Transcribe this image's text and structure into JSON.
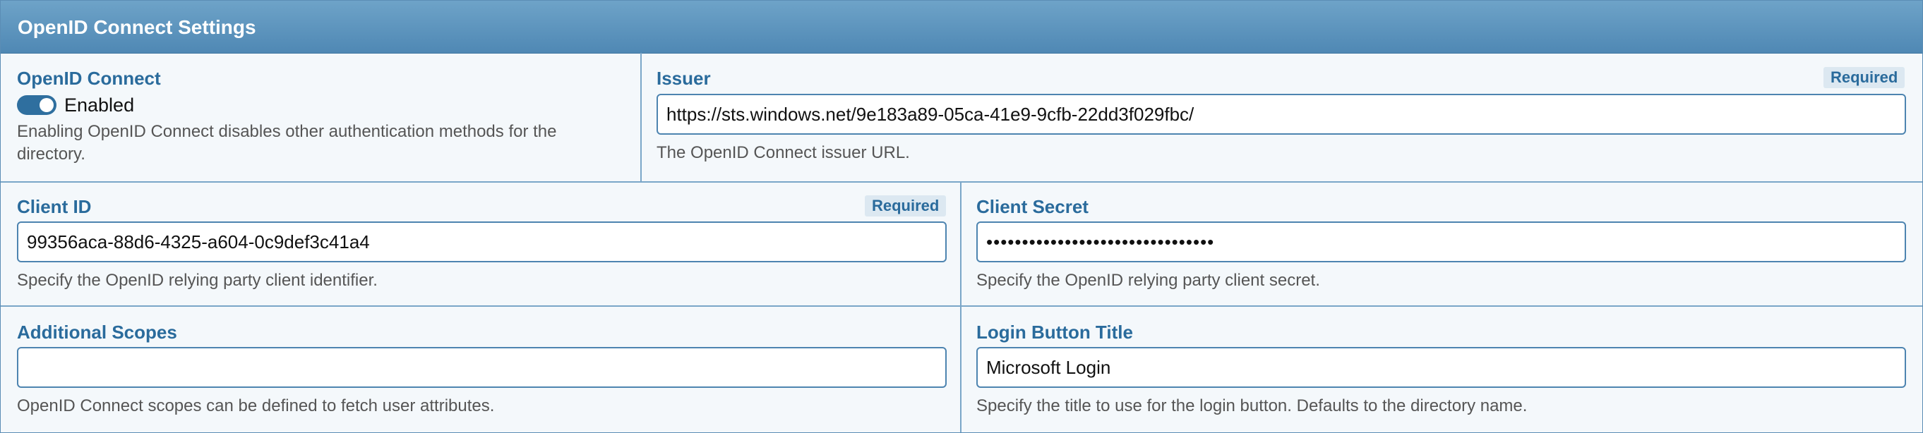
{
  "panel": {
    "title": "OpenID Connect Settings"
  },
  "openid_connect": {
    "label": "OpenID Connect",
    "toggle_state": "Enabled",
    "help": "Enabling OpenID Connect disables other authentication methods for the directory."
  },
  "issuer": {
    "label": "Issuer",
    "required": "Required",
    "value": "https://sts.windows.net/9e183a89-05ca-41e9-9cfb-22dd3f029fbc/",
    "help": "The OpenID Connect issuer URL."
  },
  "client_id": {
    "label": "Client ID",
    "required": "Required",
    "value": "99356aca-88d6-4325-a604-0c9def3c41a4",
    "help": "Specify the OpenID relying party client identifier."
  },
  "client_secret": {
    "label": "Client Secret",
    "value": "••••••••••••••••••••••••••••••••",
    "help": "Specify the OpenID relying party client secret."
  },
  "additional_scopes": {
    "label": "Additional Scopes",
    "value": "",
    "help": "OpenID Connect scopes can be defined to fetch user attributes."
  },
  "login_button_title": {
    "label": "Login Button Title",
    "value": "Microsoft Login",
    "help": "Specify the title to use for the login button. Defaults to the directory name."
  },
  "colors": {
    "header": "#5a94be",
    "label": "#2a6b9c",
    "border": "#4d84b0",
    "toggle_on": "#2f6f9f"
  }
}
